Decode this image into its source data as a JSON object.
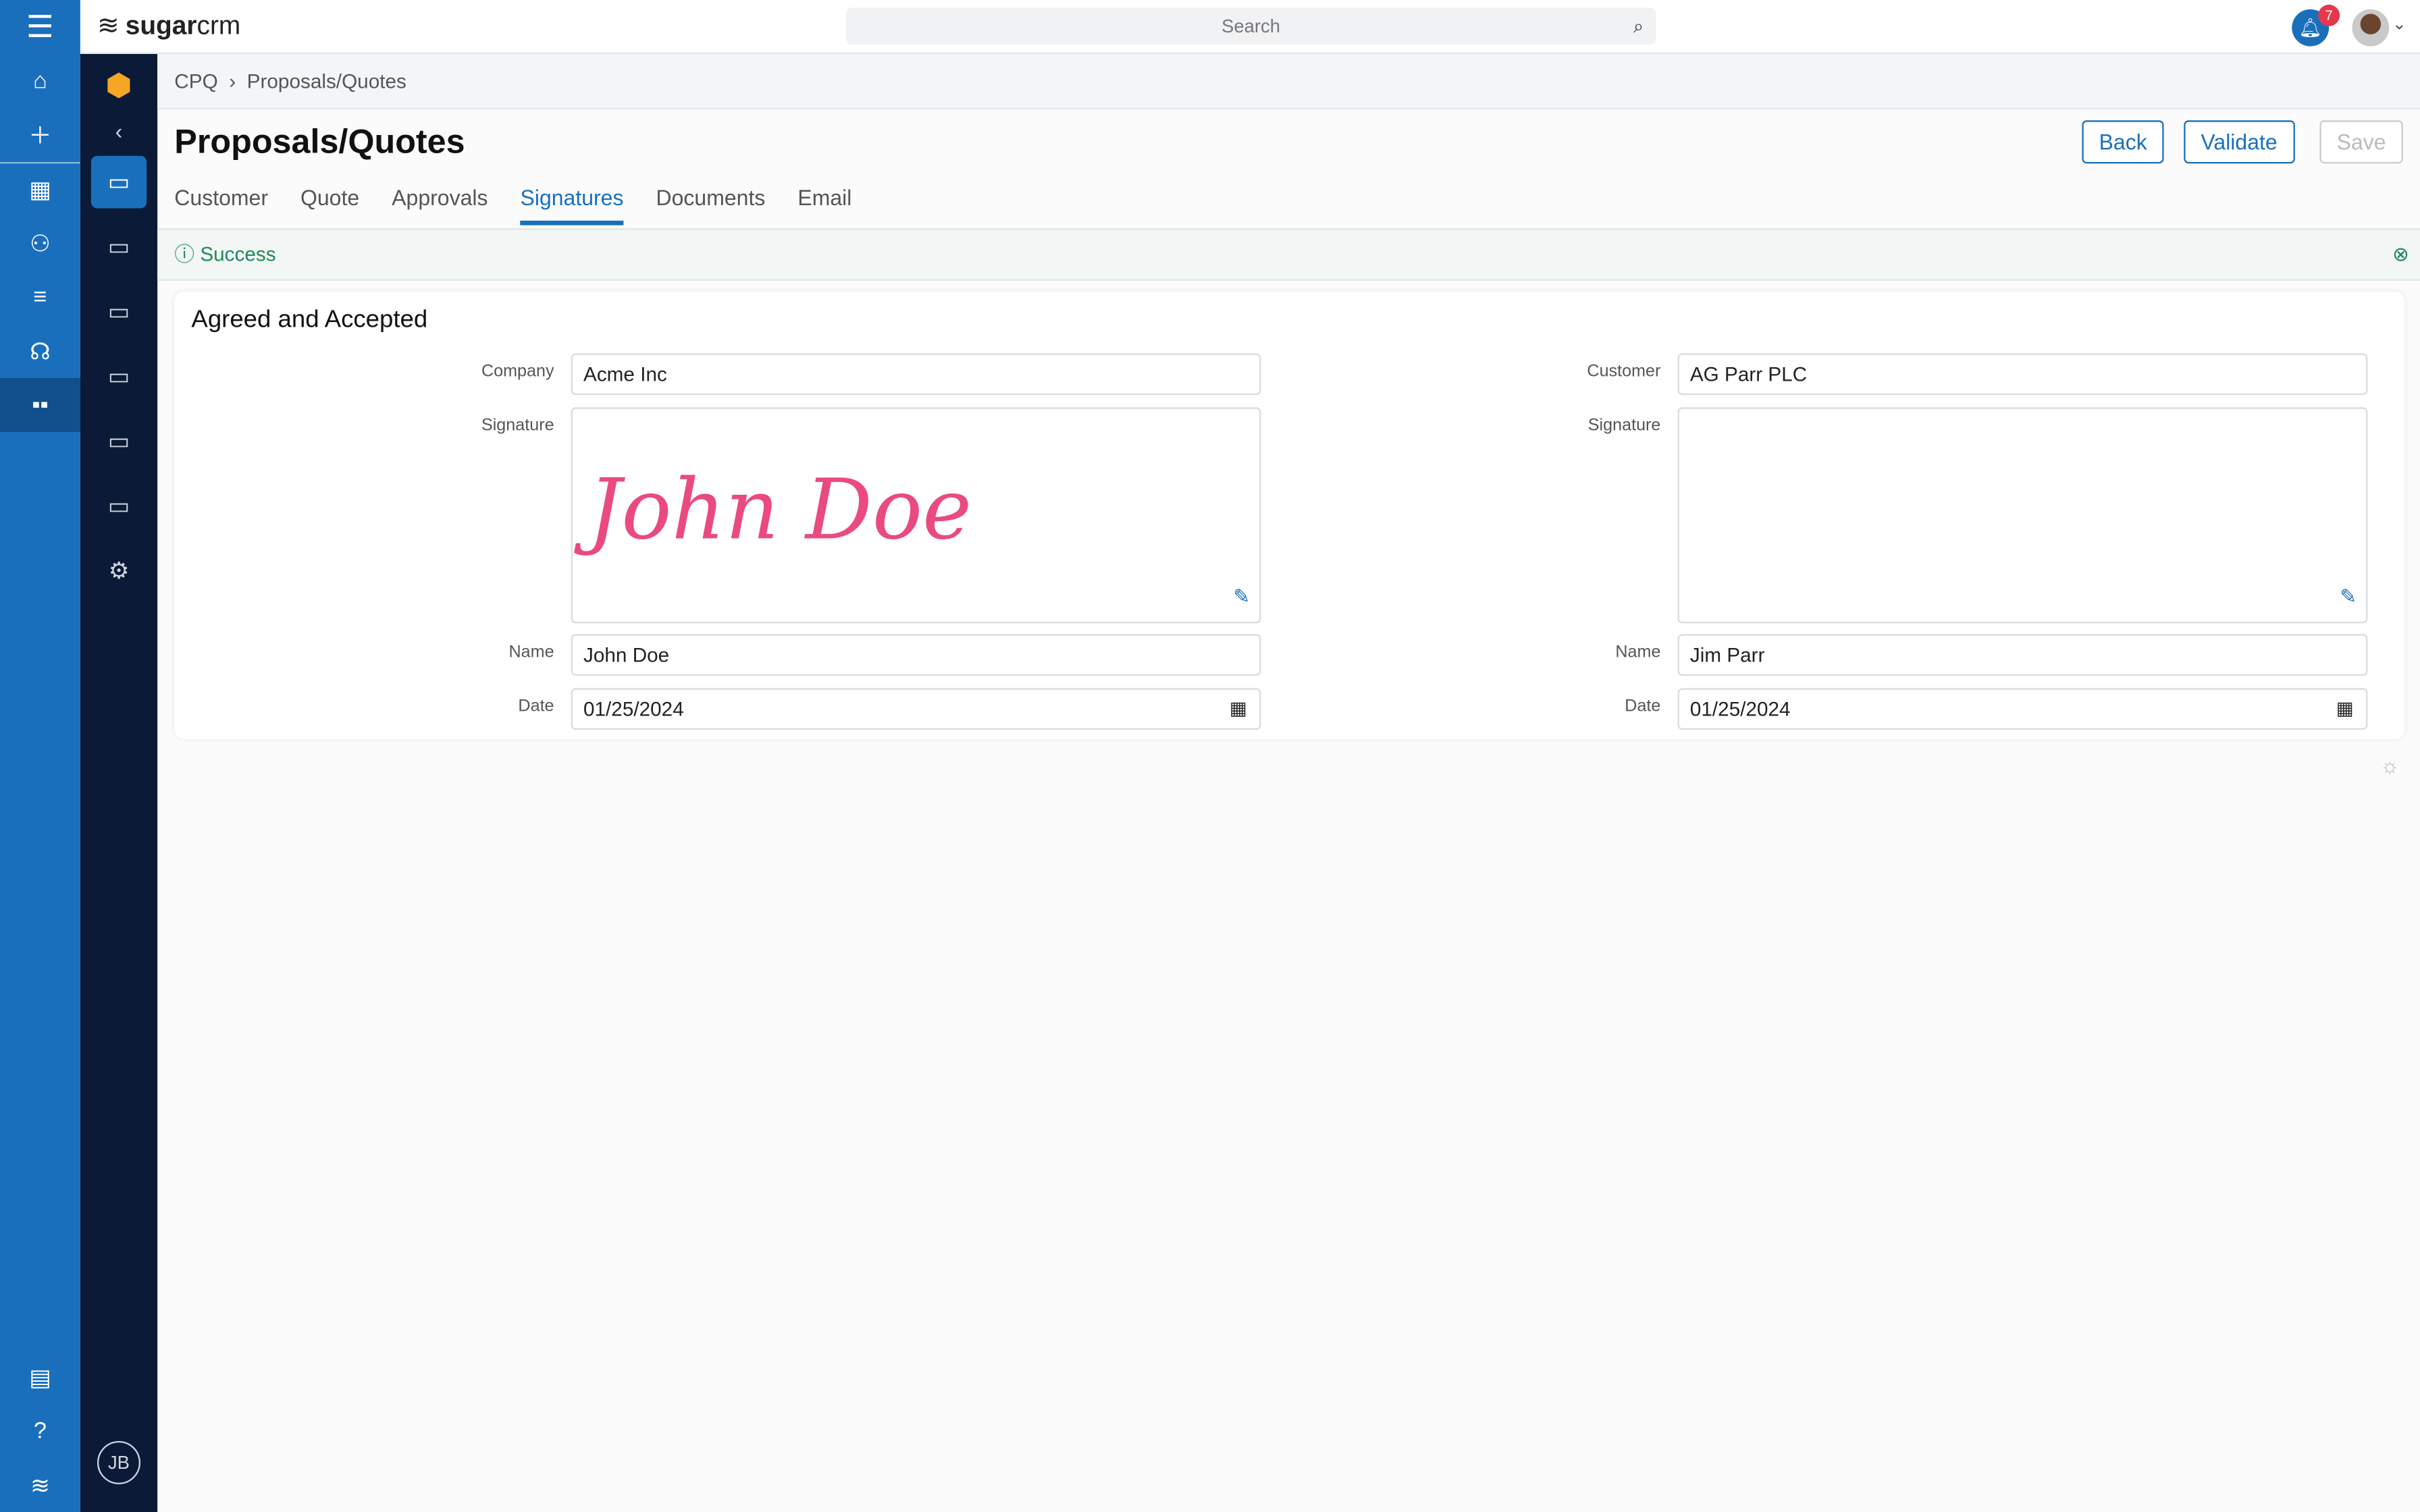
{
  "app": {
    "brand_bold": "sugar",
    "brand_light": "crm",
    "search_placeholder": "Search",
    "notifications": "7",
    "user_initials": "JB"
  },
  "breadcrumb": [
    "CPQ",
    "Proposals/Quotes"
  ],
  "page": {
    "title": "Proposals/Quotes",
    "buttons": {
      "back": "Back",
      "validate": "Validate",
      "save": "Save"
    }
  },
  "tabs": [
    {
      "label": "Customer"
    },
    {
      "label": "Quote"
    },
    {
      "label": "Approvals"
    },
    {
      "label": "Signatures",
      "active": true
    },
    {
      "label": "Documents"
    },
    {
      "label": "Email"
    }
  ],
  "alert": {
    "text": "Success"
  },
  "card": {
    "title": "Agreed and Accepted",
    "left": {
      "company_label": "Company",
      "company": "Acme Inc",
      "signature_label": "Signature",
      "signature": "John Doe",
      "name_label": "Name",
      "name": "John Doe",
      "date_label": "Date",
      "date": "01/25/2024"
    },
    "right": {
      "company_label": "Customer",
      "company": "AG Parr PLC",
      "signature_label": "Signature",
      "name_label": "Name",
      "name": "Jim Parr",
      "date_label": "Date",
      "date": "01/25/2024"
    }
  },
  "colors": {
    "accent": "#1a6fbd",
    "sidebar_dark": "#0b1a36",
    "success": "#1e8a5a",
    "signature": "#ea4a7f",
    "badge": "#e5384b"
  }
}
